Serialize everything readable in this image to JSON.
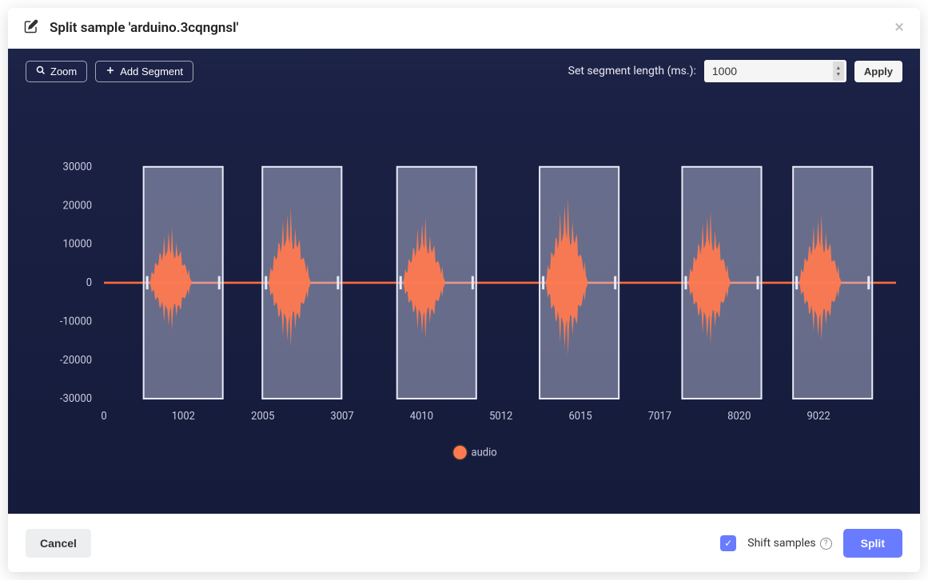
{
  "header": {
    "title": "Split sample 'arduino.3cqngnsl'"
  },
  "toolbar": {
    "zoom_label": "Zoom",
    "add_segment_label": "Add Segment",
    "segment_length_label": "Set segment length (ms.):",
    "segment_length_value": "1000",
    "apply_label": "Apply"
  },
  "footer": {
    "cancel_label": "Cancel",
    "shift_label": "Shift samples",
    "split_label": "Split",
    "shift_checked": true
  },
  "chart_data": {
    "type": "line",
    "title": "",
    "xlabel": "",
    "ylabel": "",
    "x_ticks": [
      0,
      1002,
      2005,
      3007,
      4010,
      5012,
      6015,
      7017,
      8020,
      9022
    ],
    "y_ticks": [
      -30000,
      -20000,
      -10000,
      0,
      10000,
      20000,
      30000
    ],
    "ylim": [
      -30000,
      30000
    ],
    "xlim": [
      0,
      10000
    ],
    "legend": [
      "audio"
    ],
    "segments": [
      {
        "start": 500,
        "end": 1500
      },
      {
        "start": 2000,
        "end": 3000
      },
      {
        "start": 3700,
        "end": 4700
      },
      {
        "start": 5500,
        "end": 6500
      },
      {
        "start": 7300,
        "end": 8300
      },
      {
        "start": 8700,
        "end": 9700
      }
    ],
    "series": [
      {
        "name": "audio",
        "description": "audio waveform amplitude over time (ms)"
      }
    ]
  }
}
